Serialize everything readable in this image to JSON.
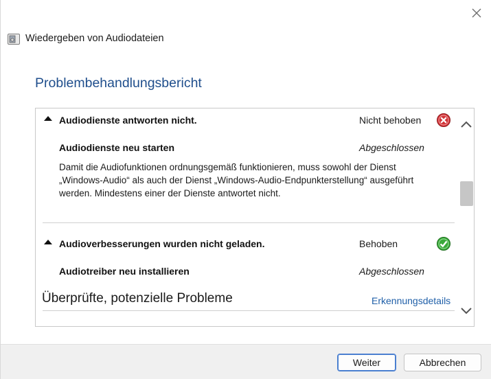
{
  "window": {
    "title": "Wiedergeben von Audiodateien",
    "close_icon": "close-icon",
    "app_icon": "audio-troubleshooter-icon"
  },
  "report": {
    "heading": "Problembehandlungsbericht",
    "issues": [
      {
        "title": "Audiodienste antworten nicht.",
        "status": "Nicht behoben",
        "status_icon": "error-x-icon",
        "status_color": "#d13438",
        "action": "Audiodienste neu starten",
        "action_status": "Abgeschlossen",
        "description": "Damit die Audiofunktionen ordnungsgemäß funktionieren, muss sowohl der Dienst „Windows-Audio“ als auch der Dienst „Windows-Audio-Endpunkterstellung“ ausgeführt werden. Mindestens einer der Dienste antwortet nicht."
      },
      {
        "title": "Audioverbesserungen wurden nicht geladen.",
        "status": "Behoben",
        "status_icon": "checkmark-icon",
        "status_color": "#2ea12e",
        "action": "Audiotreiber neu installieren",
        "action_status": "Abgeschlossen"
      }
    ],
    "scanned_title": "Überprüfte, potenzielle Probleme",
    "details_link": "Erkennungsdetails"
  },
  "buttons": {
    "next": "Weiter",
    "cancel": "Abbrechen"
  },
  "colors": {
    "heading": "#1f4e8c",
    "link": "#1f5fa8",
    "primary_button_border": "#4a7fd0"
  }
}
